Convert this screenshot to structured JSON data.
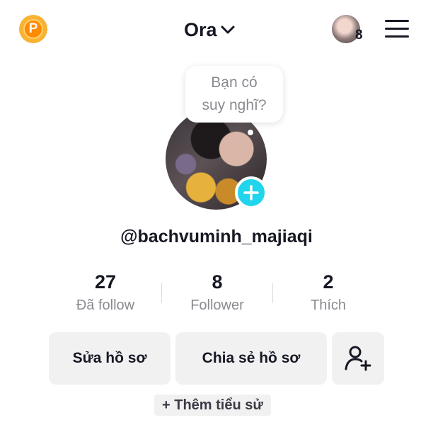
{
  "header": {
    "coin_badge_letter": "P",
    "account_name": "Ora",
    "notification_count": "8"
  },
  "profile": {
    "thought_prompt_line1": "Bạn có",
    "thought_prompt_line2": "suy nghĩ?",
    "username": "@bachvuminh_majiaqi",
    "add_badge_color": "#20d5ec"
  },
  "stats": [
    {
      "value": "27",
      "label": "Đã follow"
    },
    {
      "value": "8",
      "label": "Follower"
    },
    {
      "value": "2",
      "label": "Thích"
    }
  ],
  "actions": {
    "edit_profile": "Sửa hồ sơ",
    "share_profile": "Chia sẻ hồ sơ",
    "add_bio": "+ Thêm tiểu sử"
  },
  "icons": {
    "coin": "coin-icon",
    "dropdown": "chevron-down-icon",
    "menu": "hamburger-menu-icon",
    "add": "plus-icon",
    "add_friend": "add-user-icon"
  }
}
